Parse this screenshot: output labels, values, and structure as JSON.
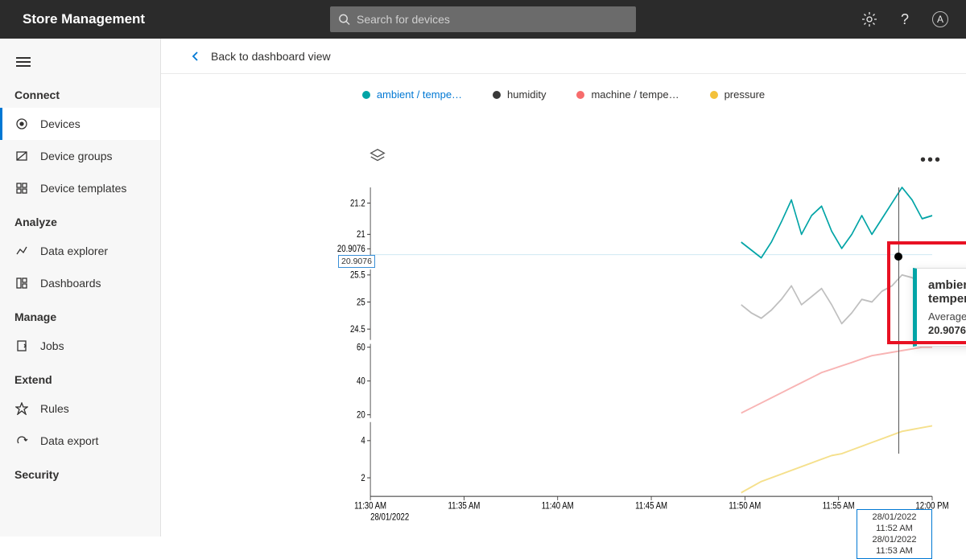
{
  "app": {
    "title": "Store Management"
  },
  "search": {
    "placeholder": "Search for devices"
  },
  "sidebar": {
    "sections": [
      {
        "label": "Connect",
        "items": [
          {
            "label": "Devices",
            "icon": "devices",
            "active": true
          },
          {
            "label": "Device groups",
            "icon": "groups"
          },
          {
            "label": "Device templates",
            "icon": "templates"
          }
        ]
      },
      {
        "label": "Analyze",
        "items": [
          {
            "label": "Data explorer",
            "icon": "explorer"
          },
          {
            "label": "Dashboards",
            "icon": "dashboards"
          }
        ]
      },
      {
        "label": "Manage",
        "items": [
          {
            "label": "Jobs",
            "icon": "jobs"
          }
        ]
      },
      {
        "label": "Extend",
        "items": [
          {
            "label": "Rules",
            "icon": "rules"
          },
          {
            "label": "Data export",
            "icon": "export"
          }
        ]
      },
      {
        "label": "Security",
        "items": []
      }
    ]
  },
  "back_link": "Back to dashboard view",
  "legend": [
    {
      "label": "ambient / tempe…",
      "color": "#00a4a6"
    },
    {
      "label": "humidity",
      "color": "#393939"
    },
    {
      "label": "machine / tempe…",
      "color": "#f76c6c"
    },
    {
      "label": "pressure",
      "color": "#f3c13a"
    }
  ],
  "tooltip": {
    "title": "ambient / temperature",
    "metric": "Average",
    "value": "20.9076",
    "accent": "#00a4a6"
  },
  "cursor": {
    "y_tag": "20.9076",
    "x_tag_line1": "28/01/2022 11:52 AM",
    "x_tag_line2": "28/01/2022 11:53 AM"
  },
  "chart_data": {
    "type": "line",
    "panels": [
      {
        "name": "ambient_temperature",
        "ylabel": "",
        "ylim": [
          20.8,
          21.3
        ],
        "yticks": [
          21.2,
          21,
          "20.9076"
        ],
        "series": [
          {
            "name": "ambient / temperature",
            "color": "#00a4a6",
            "values": [
              20.95,
              20.9,
              20.85,
              20.95,
              21.08,
              21.22,
              21.0,
              21.12,
              21.18,
              21.02,
              20.91,
              21.0,
              21.12,
              21.0,
              21.1,
              21.2,
              21.3,
              21.22,
              21.1,
              21.12
            ]
          }
        ]
      },
      {
        "name": "humidity",
        "ylabel": "",
        "ylim": [
          24.3,
          25.6
        ],
        "yticks": [
          25.5,
          25,
          24.5
        ],
        "series": [
          {
            "name": "humidity",
            "color": "#bfbfbf",
            "values": [
              24.95,
              24.8,
              24.7,
              24.85,
              25.05,
              25.3,
              24.95,
              25.1,
              25.25,
              24.95,
              24.6,
              24.8,
              25.05,
              25.0,
              25.2,
              25.3,
              25.5,
              25.45,
              25.35,
              25.4
            ]
          }
        ]
      },
      {
        "name": "machine_temperature",
        "ylabel": "",
        "ylim": [
          18,
          62
        ],
        "yticks": [
          60,
          40,
          20
        ],
        "series": [
          {
            "name": "machine / temperature",
            "color": "#f8b4b4",
            "values": [
              21,
              24,
              27,
              30,
              33,
              36,
              39,
              42,
              45,
              47,
              49,
              51,
              53,
              55,
              56,
              57,
              58,
              59,
              60,
              60
            ]
          }
        ]
      },
      {
        "name": "pressure",
        "ylabel": "",
        "ylim": [
          1,
          5
        ],
        "yticks": [
          4,
          2
        ],
        "series": [
          {
            "name": "pressure",
            "color": "#f5e08c",
            "values": [
              1.2,
              1.5,
              1.8,
              2.0,
              2.2,
              2.4,
              2.6,
              2.8,
              3.0,
              3.2,
              3.3,
              3.5,
              3.7,
              3.9,
              4.1,
              4.3,
              4.5,
              4.6,
              4.7,
              4.8
            ]
          }
        ]
      }
    ],
    "xaxis": {
      "ticks": [
        "11:30 AM",
        "11:35 AM",
        "11:40 AM",
        "11:45 AM",
        "11:50 AM",
        "11:55 AM",
        "12:00 PM"
      ],
      "date_left": "28/01/2022",
      "date_right": "28/01/2022"
    }
  }
}
